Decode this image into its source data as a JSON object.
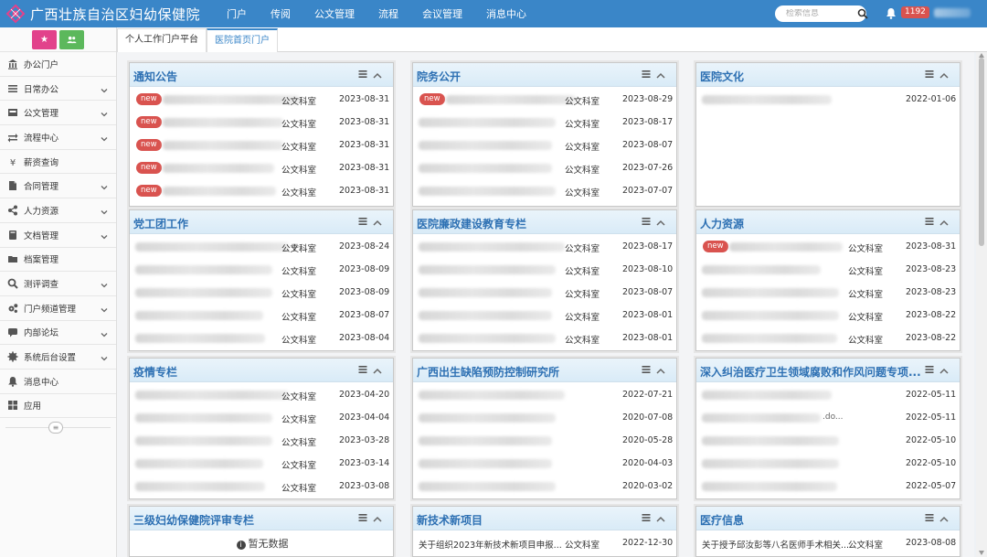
{
  "header": {
    "title": "广西壮族自治区妇幼保健院",
    "nav": [
      "门户",
      "传阅",
      "公文管理",
      "流程",
      "会议管理",
      "消息中心"
    ],
    "search_placeholder": "检索信息",
    "notification_count": "1192"
  },
  "sidebar": {
    "items": [
      {
        "label": "办公门户",
        "icon": "bank-icon",
        "expandable": false
      },
      {
        "label": "日常办公",
        "icon": "list-icon",
        "expandable": true
      },
      {
        "label": "公文管理",
        "icon": "inbox-icon",
        "expandable": true
      },
      {
        "label": "流程中心",
        "icon": "exchange-icon",
        "expandable": true
      },
      {
        "label": "薪资查询",
        "icon": "yen-icon",
        "expandable": false
      },
      {
        "label": "合同管理",
        "icon": "document-icon",
        "expandable": true
      },
      {
        "label": "人力资源",
        "icon": "share-icon",
        "expandable": true
      },
      {
        "label": "文档管理",
        "icon": "book-icon",
        "expandable": true
      },
      {
        "label": "档案管理",
        "icon": "archive-icon",
        "expandable": false
      },
      {
        "label": "测评调查",
        "icon": "magnifier-icon",
        "expandable": true
      },
      {
        "label": "门户频道管理",
        "icon": "gears-icon",
        "expandable": true
      },
      {
        "label": "内部论坛",
        "icon": "chat-icon",
        "expandable": true
      },
      {
        "label": "系统后台设置",
        "icon": "gear-icon",
        "expandable": true
      },
      {
        "label": "消息中心",
        "icon": "bell-icon",
        "expandable": false
      },
      {
        "label": "应用",
        "icon": "grid-icon",
        "expandable": false
      }
    ]
  },
  "tabs": [
    {
      "label": "个人工作门户平台",
      "active": false
    },
    {
      "label": "医院首页门户",
      "active": true
    }
  ],
  "panels": [
    {
      "title": "通知公告",
      "rows": [
        {
          "new": true,
          "dept": "公文科室",
          "date": "2023-08-31"
        },
        {
          "new": true,
          "dept": "公文科室",
          "date": "2023-08-31"
        },
        {
          "new": true,
          "dept": "公文科室",
          "date": "2023-08-31"
        },
        {
          "new": true,
          "dept": "公文科室",
          "date": "2023-08-31"
        },
        {
          "new": true,
          "dept": "公文科室",
          "date": "2023-08-31"
        }
      ]
    },
    {
      "title": "院务公开",
      "rows": [
        {
          "new": true,
          "dept": "公文科室",
          "date": "2023-08-29"
        },
        {
          "new": false,
          "dept": "公文科室",
          "date": "2023-08-17"
        },
        {
          "new": false,
          "dept": "公文科室",
          "date": "2023-08-07"
        },
        {
          "new": false,
          "dept": "公文科室",
          "date": "2023-07-26"
        },
        {
          "new": false,
          "dept": "公文科室",
          "date": "2023-07-07"
        }
      ]
    },
    {
      "title": "医院文化",
      "rows": [
        {
          "new": false,
          "dept": "",
          "date": "2022-01-06"
        }
      ]
    },
    {
      "title": "党工团工作",
      "rows": [
        {
          "new": false,
          "dept": "公文科室",
          "date": "2023-08-24",
          "fragment": "于..."
        },
        {
          "new": false,
          "dept": "公文科室",
          "date": "2023-08-09"
        },
        {
          "new": false,
          "dept": "公文科室",
          "date": "2023-08-09"
        },
        {
          "new": false,
          "dept": "公文科室",
          "date": "2023-08-07"
        },
        {
          "new": false,
          "dept": "公文科室",
          "date": "2023-08-04"
        }
      ]
    },
    {
      "title": "医院廉政建设教育专栏",
      "rows": [
        {
          "new": false,
          "dept": "公文科室",
          "date": "2023-08-17"
        },
        {
          "new": false,
          "dept": "公文科室",
          "date": "2023-08-10"
        },
        {
          "new": false,
          "dept": "公文科室",
          "date": "2023-08-07"
        },
        {
          "new": false,
          "dept": "公文科室",
          "date": "2023-08-01"
        },
        {
          "new": false,
          "dept": "公文科室",
          "date": "2023-08-01"
        }
      ]
    },
    {
      "title": "人力资源",
      "rows": [
        {
          "new": true,
          "dept": "公文科室",
          "date": "2023-08-31"
        },
        {
          "new": false,
          "dept": "公文科室",
          "date": "2023-08-23"
        },
        {
          "new": false,
          "dept": "公文科室",
          "date": "2023-08-23"
        },
        {
          "new": false,
          "dept": "公文科室",
          "date": "2023-08-22"
        },
        {
          "new": false,
          "dept": "公文科室",
          "date": "2023-08-22"
        }
      ]
    },
    {
      "title": "疫情专栏",
      "rows": [
        {
          "new": false,
          "dept": "公文科室",
          "date": "2023-04-20"
        },
        {
          "new": false,
          "dept": "公文科室",
          "date": "2023-04-04"
        },
        {
          "new": false,
          "dept": "公文科室",
          "date": "2023-03-28"
        },
        {
          "new": false,
          "dept": "公文科室",
          "date": "2023-03-14"
        },
        {
          "new": false,
          "dept": "公文科室",
          "date": "2023-03-08"
        }
      ]
    },
    {
      "title": "广西出生缺陷预防控制研究所",
      "rows": [
        {
          "new": false,
          "dept": "",
          "date": "2022-07-21"
        },
        {
          "new": false,
          "dept": "",
          "date": "2020-07-08"
        },
        {
          "new": false,
          "dept": "",
          "date": "2020-05-28"
        },
        {
          "new": false,
          "dept": "",
          "date": "2020-04-03"
        },
        {
          "new": false,
          "dept": "",
          "date": "2020-03-02"
        }
      ]
    },
    {
      "title": "深入纠治医疗卫生领域腐败和作风问题专项...",
      "rows": [
        {
          "new": false,
          "dept": "",
          "date": "2022-05-11"
        },
        {
          "new": false,
          "dept": "",
          "date": "2022-05-11",
          "fragment": ".do..."
        },
        {
          "new": false,
          "dept": "",
          "date": "2022-05-10"
        },
        {
          "new": false,
          "dept": "",
          "date": "2022-05-10"
        },
        {
          "new": false,
          "dept": "",
          "date": "2022-05-07"
        }
      ]
    },
    {
      "title": "三级妇幼保健院评审专栏",
      "empty_text": "暂无数据",
      "rows": []
    },
    {
      "title": "新技术新项目",
      "rows": [
        {
          "new": false,
          "title": "关于组织2023年新技术新项目申报...",
          "dept": "公文科室",
          "date": "2022-12-30"
        }
      ]
    },
    {
      "title": "医疗信息",
      "rows": [
        {
          "new": false,
          "title": "关于授予邱汝彭等八名医师手术相关...",
          "dept": "公文科室",
          "date": "2023-08-08"
        }
      ]
    }
  ],
  "new_badge_label": "new"
}
